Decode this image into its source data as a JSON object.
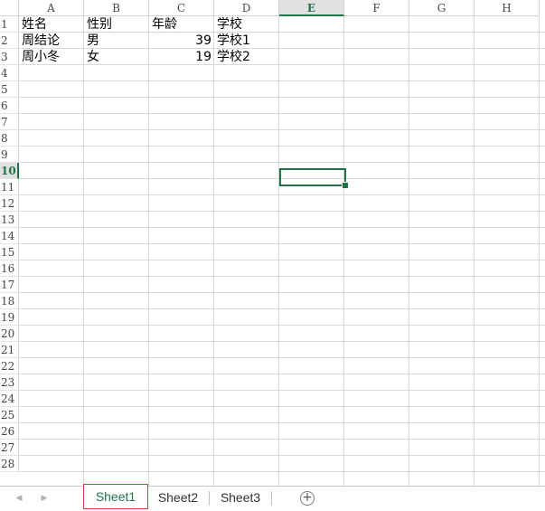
{
  "columns": [
    "A",
    "B",
    "C",
    "D",
    "E",
    "F",
    "G",
    "H"
  ],
  "active_column": "E",
  "rows": [
    "1",
    "2",
    "3",
    "4",
    "5",
    "6",
    "7",
    "8",
    "9",
    "10",
    "11",
    "12",
    "13",
    "14",
    "15",
    "16",
    "17",
    "18",
    "19",
    "20",
    "21",
    "22",
    "23",
    "24",
    "25",
    "26",
    "27",
    "28"
  ],
  "active_row": "10",
  "selected_cell": "E10",
  "cells": {
    "A1": "姓名",
    "B1": "性别",
    "C1": "年龄",
    "D1": "学校",
    "A2": "周结论",
    "B2": "男",
    "C2": "39",
    "D2": "学校1",
    "A3": "周小冬",
    "B3": "女",
    "C3": "19",
    "D3": "学校2"
  },
  "tabs": [
    "Sheet1",
    "Sheet2",
    "Sheet3"
  ],
  "active_tab": "Sheet1",
  "icons": {
    "prev_sheet": "chevron-left-icon",
    "next_sheet": "chevron-right-icon",
    "add_sheet": "plus-circle-icon"
  },
  "colors": {
    "accent": "#217346",
    "active_tab_border": "#d03b3b"
  }
}
